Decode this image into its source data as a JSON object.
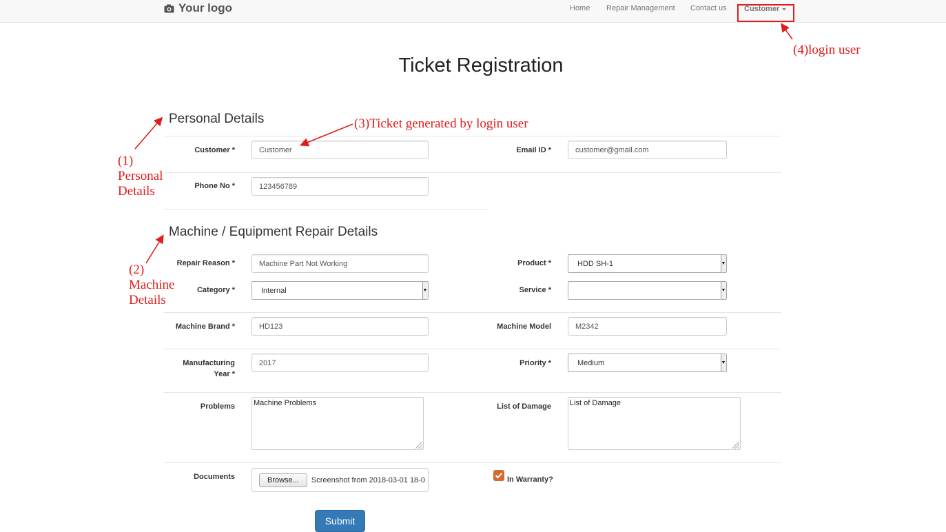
{
  "navbar": {
    "brand": "Your logo",
    "brand_icon": "camera-icon",
    "links": [
      "Home",
      "Repair Management",
      "Contact us"
    ],
    "user_menu": "Customer"
  },
  "page_title": "Ticket Registration",
  "sections": {
    "personal": "Personal Details",
    "machine": "Machine / Equipment Repair Details"
  },
  "fields": {
    "customer": {
      "label": "Customer *",
      "value": "Customer"
    },
    "email": {
      "label": "Email ID *",
      "value": "customer@gmail.com"
    },
    "phone": {
      "label": "Phone No *",
      "value": "123456789"
    },
    "repair_reason": {
      "label": "Repair Reason *",
      "value": "Machine Part Not Working"
    },
    "product": {
      "label": "Product *",
      "value": "HDD SH-1"
    },
    "category": {
      "label": "Category *",
      "value": "Internal"
    },
    "service": {
      "label": "Service *",
      "value": ""
    },
    "machine_brand": {
      "label": "Machine Brand *",
      "value": "HD123"
    },
    "machine_model": {
      "label": "Machine Model",
      "value": "M2342"
    },
    "manufacturing_year": {
      "label_line1": "Manufacturing",
      "label_line2": "Year *",
      "value": "2017"
    },
    "priority": {
      "label": "Priority *",
      "value": "Medium"
    },
    "problems": {
      "label": "Problems",
      "value": "Machine Problems"
    },
    "damage": {
      "label": "List of Damage",
      "value": "List of Damage"
    },
    "documents": {
      "label": "Documents",
      "button": "Browse...",
      "filename": "Screenshot from 2018-03-01 18-0"
    },
    "warranty": {
      "label": "In Warranty?",
      "checked": true
    }
  },
  "submit": "Submit",
  "annotations": {
    "a1": [
      "(1)",
      "Personal",
      "Details"
    ],
    "a2": [
      "(2)",
      "Machine",
      "Details"
    ],
    "a3": "(3)Ticket generated by login user",
    "a4": "(4)login user"
  },
  "colors": {
    "annotation": "#e21b1b",
    "primary": "#337ab7",
    "checkbox": "#d46a2f"
  }
}
